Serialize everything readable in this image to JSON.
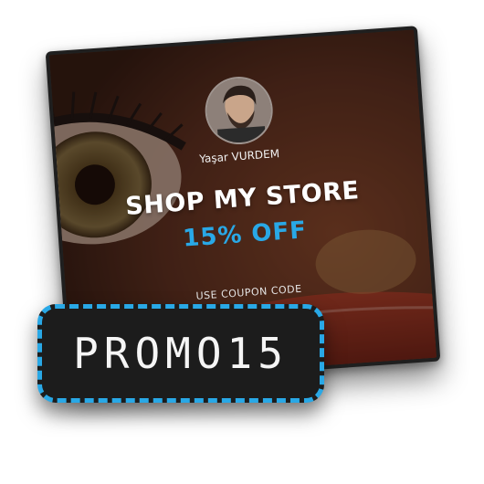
{
  "card": {
    "username": "Yaşar VURDEM",
    "headline": "SHOP MY STORE",
    "discount": "15% OFF",
    "coupon_label": "USE COUPON CODE"
  },
  "coupon": {
    "code": "PROMO15"
  },
  "colors": {
    "accent": "#29a8e6",
    "badge_background": "#1c1c1c",
    "headline_text": "#ffffff"
  },
  "icons": {
    "avatar": "profile-photo"
  }
}
